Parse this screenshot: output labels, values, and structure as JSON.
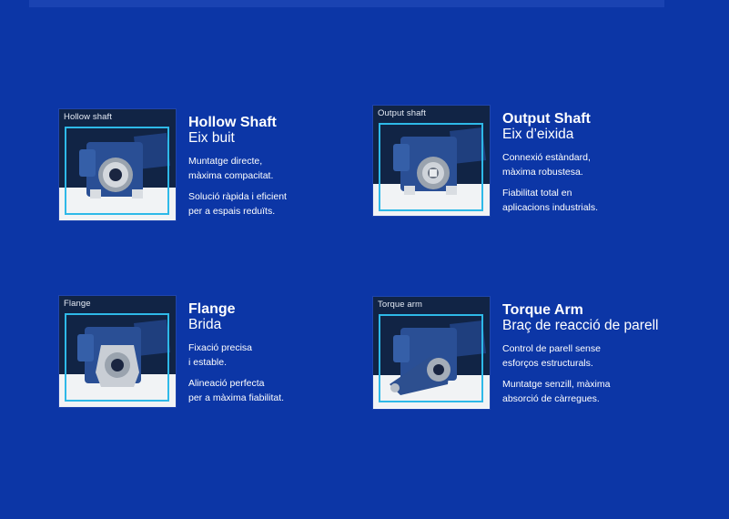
{
  "colors": {
    "background": "#0c36a6",
    "frame_accent": "#2eb9e8",
    "thumb_dark": "#112445",
    "gear_blue": "#2a4f95"
  },
  "cards": [
    {
      "thumb_label": "Hollow shaft",
      "title": "Hollow Shaft",
      "subtitle": "Eix buit",
      "desc1": "Muntatge directe,\nmàxima compacitat.",
      "desc2": "Solució ràpida i eficient\nper a espais reduïts.",
      "image_icon": "hollow-shaft-gearbox-icon"
    },
    {
      "thumb_label": "Output shaft",
      "title": "Output Shaft",
      "subtitle": "Eix d’eixida",
      "desc1": "Connexió estàndard,\nmàxima robustesa.",
      "desc2": "Fiabilitat total en\naplicacions industrials.",
      "image_icon": "output-shaft-gearbox-icon"
    },
    {
      "thumb_label": "Flange",
      "title": "Flange",
      "subtitle": "Brida",
      "desc1": "Fixació precisa\ni estable.",
      "desc2": "Alineació perfecta\nper a màxima fiabilitat.",
      "image_icon": "flange-gearbox-icon"
    },
    {
      "thumb_label": "Torque arm",
      "title": "Torque Arm",
      "subtitle": "Braç de reacció de parell",
      "desc1": "Control de parell sense\nesforços estructurals.",
      "desc2": "Muntatge senzill, màxima\nabsorció de càrregues.",
      "image_icon": "torque-arm-gearbox-icon"
    }
  ]
}
